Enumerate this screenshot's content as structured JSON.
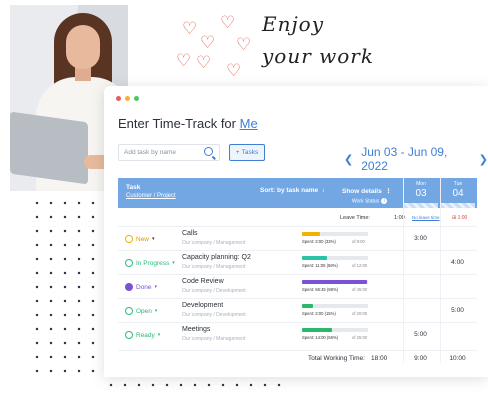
{
  "doodle": {
    "line1": "Enjoy",
    "line2": "your work"
  },
  "window": {
    "title_prefix": "Enter Time-Track for",
    "title_user": "Me"
  },
  "toolbar": {
    "search_placeholder": "Add task by name",
    "tasks_label": "Tasks",
    "date_range": "Jun 03 - Jun 09, 2022"
  },
  "table": {
    "task_header": "Task",
    "task_subheader": "Customer / Project",
    "sort_label": "Sort: by task name",
    "show_details": "Show details",
    "work_status": "Work Status",
    "days": [
      {
        "name": "Mon",
        "num": "03"
      },
      {
        "name": "Tue",
        "num": "04"
      }
    ],
    "leave_label": "Leave Time:",
    "leave_value": "1:00",
    "leave_link": "No leave time",
    "leave_right": "1:00",
    "rows": [
      {
        "status": "New",
        "name": "Calls",
        "sub": "Our company / Management",
        "progress": 0.27,
        "spent": "Spent: 3:00 (33%)",
        "of": "of 9:00",
        "mon": "3:00",
        "tue": ""
      },
      {
        "status": "In Progress",
        "name": "Capacity planning: Q2",
        "sub": "Our company / Management",
        "progress": 0.38,
        "spent": "Spent: 11:05 (56%)",
        "of": "of 12:00",
        "mon": "",
        "tue": "4:00"
      },
      {
        "status": "Done",
        "name": "Code Review",
        "sub": "Our company / Development",
        "progress": 0.98,
        "spent": "Spent: 66:45 (98%)",
        "of": "of 45:00",
        "mon": "",
        "tue": ""
      },
      {
        "status": "Open",
        "name": "Development",
        "sub": "Our company / Development",
        "progress": 0.17,
        "spent": "Spent: 3:00 (15%)",
        "of": "of 20:00",
        "mon": "",
        "tue": "5:00"
      },
      {
        "status": "Ready",
        "name": "Meetings",
        "sub": "Our company / Management",
        "progress": 0.46,
        "spent": "Spent: 14:00 (56%)",
        "of": "of 25:00",
        "mon": "5:00",
        "tue": ""
      }
    ],
    "total_label": "Total Working Time:",
    "total_value": "18:00",
    "total_mon": "9:00",
    "total_tue": "10:00"
  },
  "colors": {
    "accent": "#3d7fd6",
    "header": "#72a7e3",
    "status_new": "#f0b400",
    "status_in_progress": "#2db87d",
    "status_done": "#7b52d6",
    "status_open": "#2db87d",
    "status_ready": "#2db87d",
    "bar_new": "#f0b400",
    "bar_in_progress": "#2ac3a8",
    "bar_done": "#7b52d6",
    "bar_open": "#2ab86a",
    "bar_ready": "#2ab86a"
  }
}
